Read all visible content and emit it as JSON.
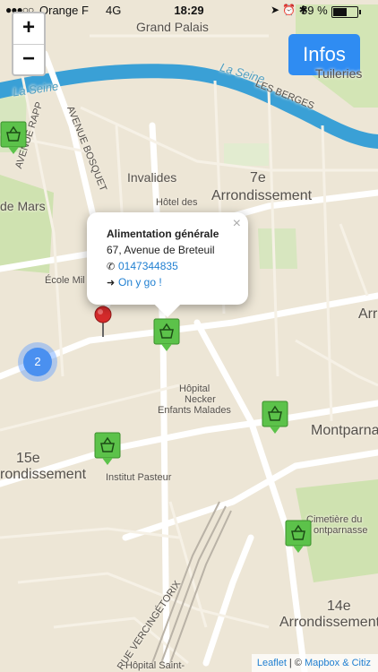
{
  "status_bar": {
    "signal_dots": "●●●○○",
    "carrier": "Orange F",
    "network": "4G",
    "time": "18:29",
    "status_icons": "➤ ⏰ ✱",
    "battery_percent": "59 %",
    "battery_level": 0.59
  },
  "zoom": {
    "zoom_in": "+",
    "zoom_out": "−"
  },
  "infos_button": "Infos",
  "map_labels": {
    "grand_palais": "Grand Palais",
    "la_seine_left": "La Seine",
    "la_seine_right": "La Seine",
    "les_berges": "LES BERGES",
    "tuileries": "Tuileries",
    "avenue_rapp": "AVENUE RAPP",
    "avenue_bosquet": "AVENUE BOSQUET",
    "invalides": "Invalides",
    "hotel_des": "Hôtel des",
    "arr_7e_number": "7e",
    "arr_7e_word": "Arrondissement",
    "de_mars": "de Mars",
    "ecole_mil": "École Mil",
    "arr_right": "Arr",
    "hopital_necker": "Hôpital",
    "necker_enfants": "Necker",
    "enfants_malades": "Enfants Malades",
    "montparnasse": "Montparna",
    "arr_15e_number": "15e",
    "arr_15e_word": "rondissement",
    "institut_pasteur": "Institut Pasteur",
    "cimetiere": "Cimetière du",
    "montparnasse2": "ontparnasse",
    "arr_14e_number": "14e",
    "arr_14e_word": "Arrondissement",
    "rue_vercingetorix": "RUE VERCINGÉTORIX",
    "hopital_saint": "Hôpital Saint-"
  },
  "cluster_count": "2",
  "popup": {
    "close": "×",
    "title": "Alimentation générale",
    "address": "67, Avenue de Breteuil",
    "phone_icon": "phone-icon",
    "phone": "0147344835",
    "go_icon": "arrow-circle-icon",
    "go_label": "On y go !"
  },
  "attribution": {
    "leaflet": "Leaflet",
    "separator": " | © ",
    "mapbox": "Mapbox & Citiz"
  },
  "colors": {
    "map_background": "#ede6d6",
    "park": "#cfe2b0",
    "river": "#3aa0d6",
    "accent_button": "#2f8cf2",
    "marker_green": "#5cc24a",
    "cluster_blue": "#4a90f0",
    "pin_red": "#d62b2b"
  }
}
